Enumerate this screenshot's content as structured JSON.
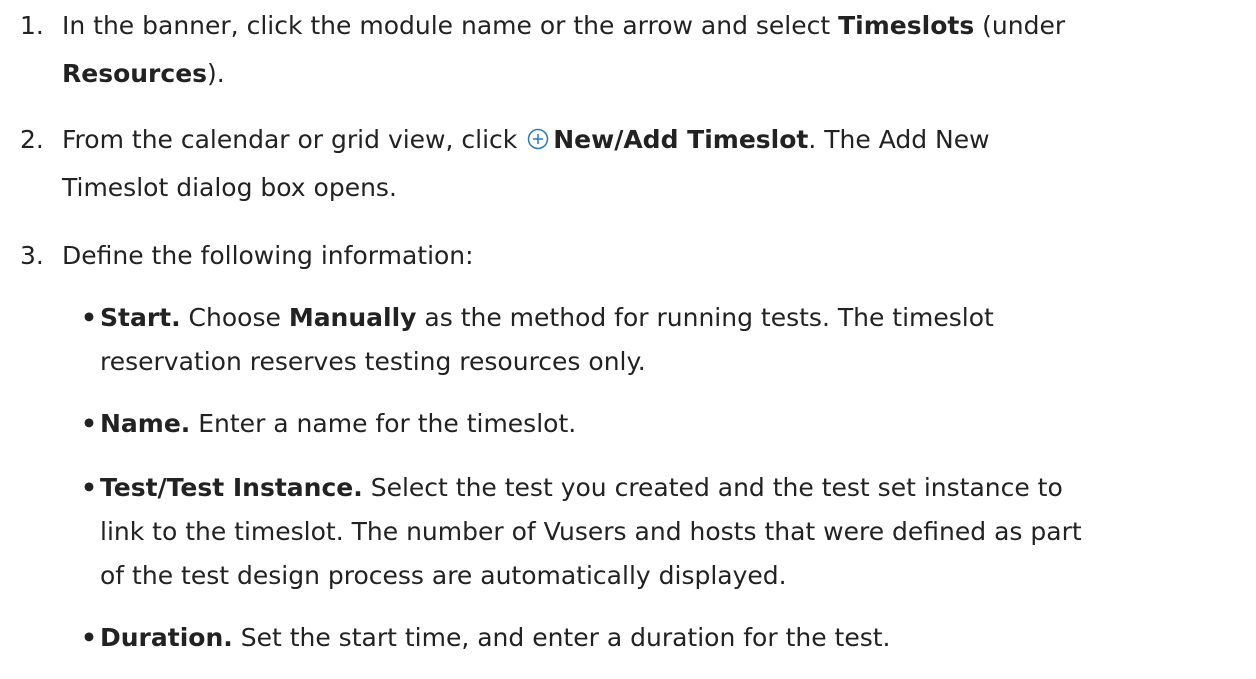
{
  "steps": [
    {
      "number": "1.",
      "l1_pre": "In the banner, click the module name or the arrow and select ",
      "l1_bold": "Timeslots",
      "l1_post": " (under",
      "l2_bold": "Resources",
      "l2_post": ")."
    },
    {
      "number": "2.",
      "l1_pre": "From the calendar or grid view, click ",
      "icon": "add-circle-icon",
      "l1_bold": "New/Add Timeslot",
      "l1_post": ". The Add New",
      "l2_text": "Timeslot dialog box opens."
    },
    {
      "number": "3.",
      "text": "Define the following information:"
    }
  ],
  "bullets": [
    {
      "dot": "•",
      "label": "Start.",
      "l1_pre": " Choose ",
      "l1_bold": "Manually",
      "l1_post": " as the method for running tests. The timeslot",
      "l2": "reservation reserves testing resources only."
    },
    {
      "dot": "•",
      "label": "Name.",
      "l1_post": " Enter a name for the timeslot."
    },
    {
      "dot": "•",
      "label": "Test/Test Instance.",
      "l1_post": " Select the test you created and the test set instance to",
      "l2": "link to the timeslot. The number of Vusers and hosts that were defined as part",
      "l3": "of the test design process are automatically displayed."
    },
    {
      "dot": "•",
      "label": "Duration.",
      "l1_post": " Set the start time, and enter a duration for the test."
    }
  ],
  "colors": {
    "text": "#222222",
    "icon": "#2a7ab8"
  }
}
